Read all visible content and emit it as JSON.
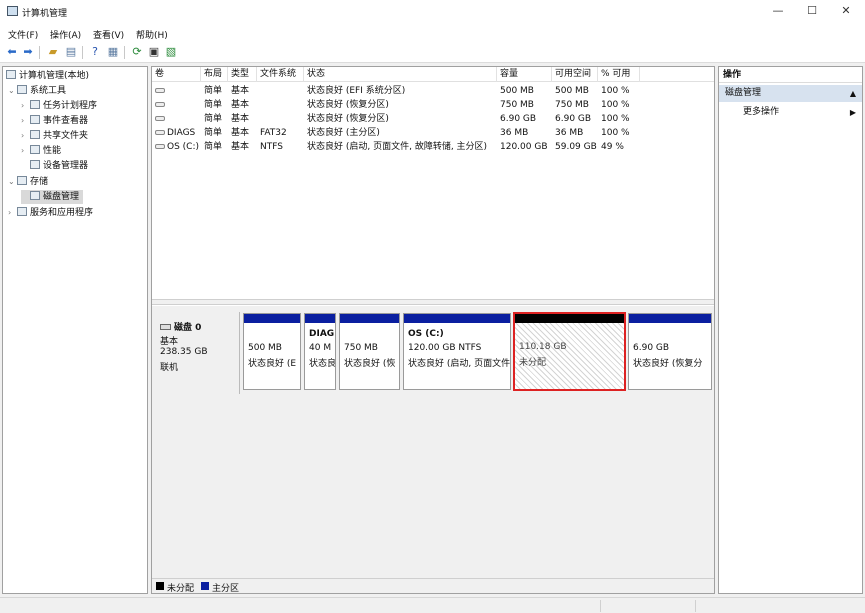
{
  "window": {
    "title": "计算机管理",
    "minimize_glyph": "—",
    "maximize_glyph": "☐",
    "close_glyph": "✕"
  },
  "menu": [
    "文件(F)",
    "操作(A)",
    "查看(V)",
    "帮助(H)"
  ],
  "toolbar_icons": [
    "back-icon",
    "forward-icon",
    "up-folder-icon",
    "show-tree-icon",
    "help-icon",
    "view-icon",
    "refresh-icon",
    "properties-icon",
    "export-icon"
  ],
  "tree": {
    "root": "计算机管理(本地)",
    "system_tools": "系统工具",
    "task_scheduler": "任务计划程序",
    "event_viewer": "事件查看器",
    "shared_folders": "共享文件夹",
    "performance": "性能",
    "device_manager": "设备管理器",
    "storage": "存储",
    "disk_management": "磁盘管理",
    "services_apps": "服务和应用程序"
  },
  "volume_table": {
    "headers": [
      "卷",
      "布局",
      "类型",
      "文件系统",
      "状态",
      "容量",
      "可用空间",
      "% 可用"
    ],
    "rows": [
      [
        "",
        "简单",
        "基本",
        "",
        "状态良好 (EFI 系统分区)",
        "500 MB",
        "500 MB",
        "100 %"
      ],
      [
        "",
        "简单",
        "基本",
        "",
        "状态良好 (恢复分区)",
        "750 MB",
        "750 MB",
        "100 %"
      ],
      [
        "",
        "简单",
        "基本",
        "",
        "状态良好 (恢复分区)",
        "6.90 GB",
        "6.90 GB",
        "100 %"
      ],
      [
        "DIAGS",
        "简单",
        "基本",
        "FAT32",
        "状态良好 (主分区)",
        "36 MB",
        "36 MB",
        "100 %"
      ],
      [
        "OS (C:)",
        "简单",
        "基本",
        "NTFS",
        "状态良好 (启动, 页面文件, 故障转储, 主分区)",
        "120.00 GB",
        "59.09 GB",
        "49 %"
      ]
    ]
  },
  "disk": {
    "name": "磁盘 0",
    "type": "基本",
    "size": "238.35 GB",
    "status": "联机",
    "partitions": [
      {
        "title": "",
        "size": "500 MB",
        "status": "状态良好 (E"
      },
      {
        "title": "DIAG",
        "size": "40 M",
        "status": "状态良"
      },
      {
        "title": "",
        "size": "750 MB",
        "status": "状态良好 (恢"
      },
      {
        "title": "OS (C:)",
        "size": "120.00 GB NTFS",
        "status": "状态良好 (启动, 页面文件"
      },
      {
        "title": "",
        "size": "110.18 GB",
        "status": "未分配"
      },
      {
        "title": "",
        "size": "6.90 GB",
        "status": "状态良好 (恢复分"
      }
    ]
  },
  "legend": {
    "unallocated": "未分配",
    "primary": "主分区",
    "unallocated_color": "#000000",
    "primary_color": "#0a1fa0"
  },
  "actions": {
    "title": "操作",
    "section": "磁盘管理",
    "more": "更多操作"
  }
}
